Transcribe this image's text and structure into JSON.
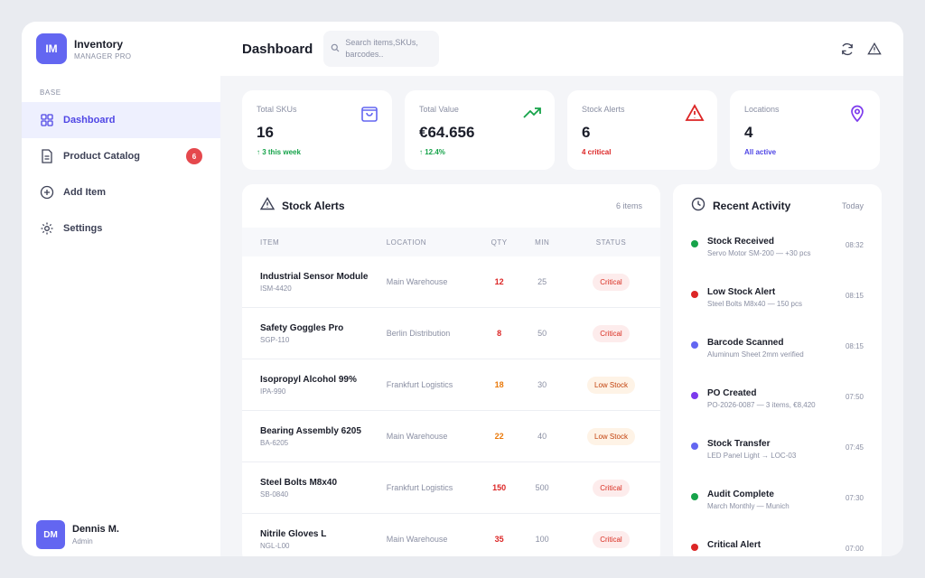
{
  "brand": {
    "logo": "IM",
    "name": "Inventory",
    "subtitle": "MANAGER PRO"
  },
  "sidebar": {
    "section_label": "BASE",
    "items": [
      {
        "label": "Dashboard",
        "icon": "grid-icon",
        "active": true
      },
      {
        "label": "Product Catalog",
        "icon": "document-icon",
        "badge": "6"
      },
      {
        "label": "Add Item",
        "icon": "plus-circle-icon"
      },
      {
        "label": "Settings",
        "icon": "gear-icon"
      }
    ]
  },
  "user": {
    "initials": "DM",
    "name": "Dennis M.",
    "role": "Admin"
  },
  "header": {
    "title": "Dashboard",
    "search_placeholder": "Search items,SKUs, barcodes..",
    "actions": [
      "refresh-icon",
      "warning-icon"
    ]
  },
  "stats": [
    {
      "label": "Total SKUs",
      "value": "16",
      "sub": "↑ 3 this week",
      "sub_color": "#16a34a",
      "icon": "bag-icon"
    },
    {
      "label": "Total Value",
      "value": "€64.656",
      "sub": "↑ 12.4%",
      "sub_color": "#16a34a",
      "icon": "trend-up-icon"
    },
    {
      "label": "Stock Alerts",
      "value": "6",
      "sub": "4 critical",
      "sub_color": "#dc2626",
      "icon": "alert-icon"
    },
    {
      "label": "Locations",
      "value": "4",
      "sub": "All active",
      "sub_color": "#4f46e5",
      "icon": "pin-icon"
    }
  ],
  "alerts": {
    "title": "Stock Alerts",
    "count": "6 items",
    "columns": [
      "ITEM",
      "LOCATION",
      "QTY",
      "MIN",
      "STATUS"
    ],
    "rows": [
      {
        "name": "Industrial Sensor Module",
        "sku": "ISM-4420",
        "location": "Main Warehouse",
        "qty": "12",
        "min": "25",
        "status": "Critical"
      },
      {
        "name": "Safety Goggles Pro",
        "sku": "SGP-110",
        "location": "Berlin Distribution",
        "qty": "8",
        "min": "50",
        "status": "Critical"
      },
      {
        "name": "Isopropyl Alcohol 99%",
        "sku": "IPA-990",
        "location": "Frankfurt Logistics",
        "qty": "18",
        "min": "30",
        "status": "Low Stock"
      },
      {
        "name": "Bearing Assembly 6205",
        "sku": "BA-6205",
        "location": "Main Warehouse",
        "qty": "22",
        "min": "40",
        "status": "Low Stock"
      },
      {
        "name": "Steel Bolts M8x40",
        "sku": "SB-0840",
        "location": "Frankfurt Logistics",
        "qty": "150",
        "min": "500",
        "status": "Critical"
      },
      {
        "name": "Nitrile Gloves L",
        "sku": "NGL-L00",
        "location": "Main Warehouse",
        "qty": "35",
        "min": "100",
        "status": "Critical"
      }
    ]
  },
  "activity": {
    "title": "Recent Activity",
    "period": "Today",
    "items": [
      {
        "title": "Stock Received",
        "desc": "Servo Motor SM-200 — +30 pcs",
        "time": "08:32",
        "color": "#16a34a"
      },
      {
        "title": "Low Stock Alert",
        "desc": "Steel Bolts M8x40 — 150 pcs",
        "time": "08:15",
        "color": "#dc2626"
      },
      {
        "title": "Barcode Scanned",
        "desc": "Aluminum Sheet 2mm verified",
        "time": "08:15",
        "color": "#6366f1"
      },
      {
        "title": "PO Created",
        "desc": "PO-2026-0087 — 3 items, €8,420",
        "time": "07:50",
        "color": "#7c3aed"
      },
      {
        "title": "Stock Transfer",
        "desc": "LED Panel Light → LOC-03",
        "time": "07:45",
        "color": "#6366f1"
      },
      {
        "title": "Audit Complete",
        "desc": "March Monthly — Munich",
        "time": "07:30",
        "color": "#16a34a"
      },
      {
        "title": "Critical Alert",
        "desc": "",
        "time": "07:00",
        "color": "#dc2626"
      }
    ]
  }
}
